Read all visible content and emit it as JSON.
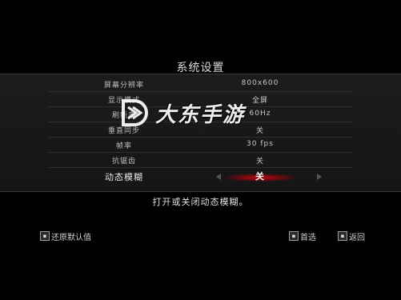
{
  "title": "系统设置",
  "settings": [
    {
      "label": "屏幕分辨率",
      "value": "800x600"
    },
    {
      "label": "显示模式",
      "value": "全屏"
    },
    {
      "label": "刷新率",
      "value": "60Hz"
    },
    {
      "label": "垂直同步",
      "value": "关"
    },
    {
      "label": "帧率",
      "value": "30 fps"
    },
    {
      "label": "抗锯齿",
      "value": "关"
    },
    {
      "label": "动态模糊",
      "value": "关"
    }
  ],
  "description": "打开或关闭动态模糊。",
  "footer": {
    "restore_defaults": "还原默认值",
    "confirm": "首选",
    "back": "返回"
  },
  "watermark": {
    "text": "大东手游"
  },
  "colors": {
    "highlight": "#c80a14",
    "background": "#000000"
  }
}
